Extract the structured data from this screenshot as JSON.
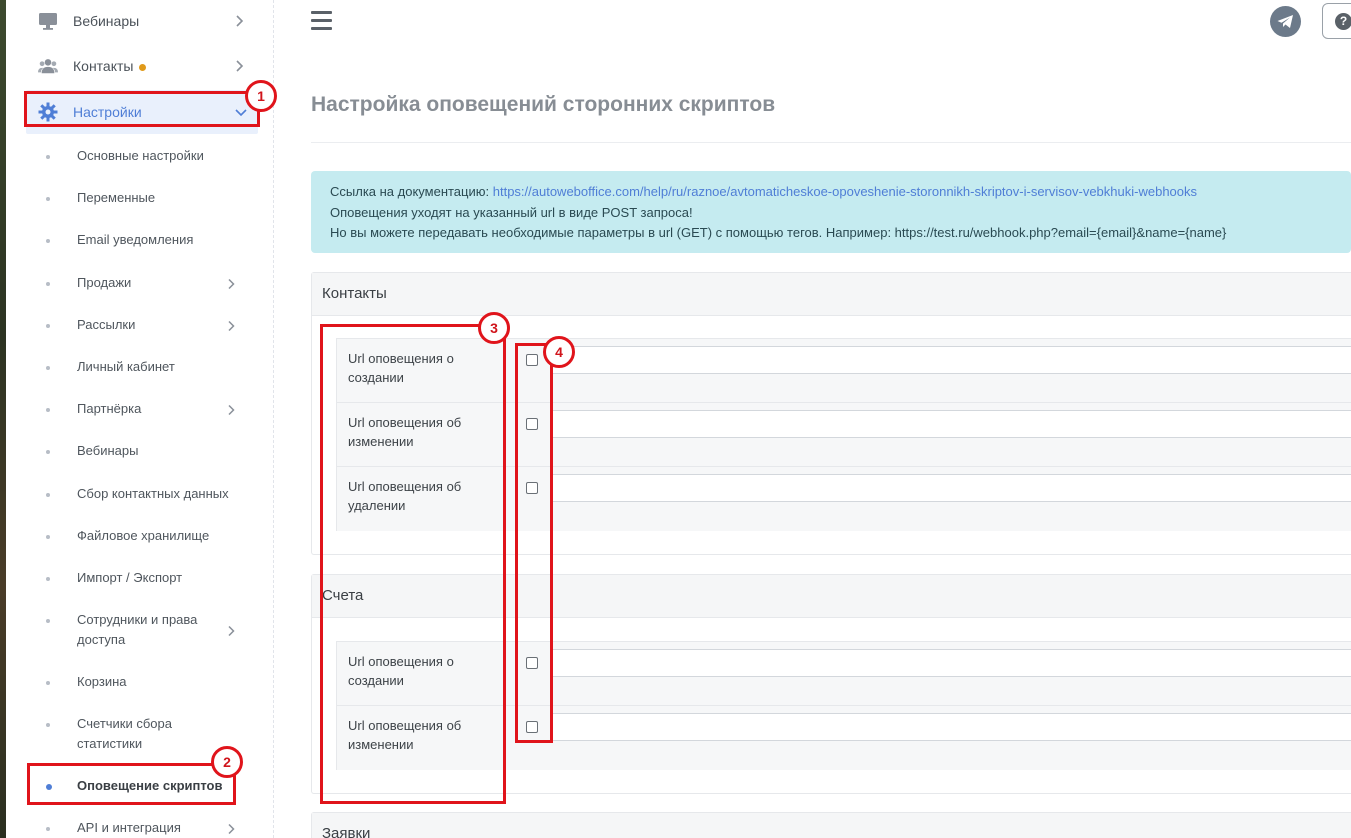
{
  "sidebar": {
    "top_items": [
      {
        "label": "Вебинары",
        "icon": "monitor-icon"
      },
      {
        "label": "Контакты",
        "icon": "users-icon"
      },
      {
        "label": "Настройки",
        "icon": "gear-icon"
      }
    ],
    "sub_items": [
      {
        "label": "Основные настройки"
      },
      {
        "label": "Переменные"
      },
      {
        "label": "Email уведомления"
      },
      {
        "label": "Продажи"
      },
      {
        "label": "Рассылки"
      },
      {
        "label": "Личный кабинет"
      },
      {
        "label": "Партнёрка"
      },
      {
        "label": "Вебинары"
      },
      {
        "label": "Сбор контактных данных"
      },
      {
        "label": "Файловое хранилище"
      },
      {
        "label": "Импорт / Экспорт"
      },
      {
        "label": "Сотрудники и права доступа"
      },
      {
        "label": "Корзина"
      },
      {
        "label": "Счетчики сбора статистики"
      },
      {
        "label": "Оповещение скриптов"
      },
      {
        "label": "API и интеграция"
      }
    ],
    "colors": {
      "active": "#4f7ed6",
      "notification_dot": "#e09a1a"
    }
  },
  "header": {
    "menu_icon": "hamburger-icon",
    "telegram_icon": "telegram-icon",
    "help_icon": "question-icon",
    "help_glyph": "?"
  },
  "page": {
    "title": "Настройка оповещений сторонних скриптов",
    "info": {
      "doc_prefix": "Ссылка на документацию: ",
      "doc_link": "https://autoweboffice.com/help/ru/raznoe/avtomaticheskoe-opoveshenie-storonnikh-skriptov-i-servisov-vebkhuki-webhooks",
      "line2": "Оповещения уходят на указанный url в виде POST запроса!",
      "line3": "Но вы можете передавать необходимые параметры в url (GET) с помощью тегов. Например: https://test.ru/webhook.php?email={email}&name={name}"
    },
    "sections": [
      {
        "title": "Контакты",
        "rows": [
          {
            "label": "Url оповещения о создании",
            "value": "",
            "checked": false
          },
          {
            "label": "Url оповещения об изменении",
            "value": "",
            "checked": false
          },
          {
            "label": "Url оповещения об удалении",
            "value": "",
            "checked": false
          }
        ]
      },
      {
        "title": "Счета",
        "rows": [
          {
            "label": "Url оповещения о создании",
            "value": "",
            "checked": false
          },
          {
            "label": "Url оповещения об изменении",
            "value": "",
            "checked": false
          }
        ]
      },
      {
        "title": "Заявки"
      }
    ]
  },
  "annotations": {
    "color": "#e0141b",
    "markers": [
      "1",
      "2",
      "3",
      "4"
    ]
  }
}
